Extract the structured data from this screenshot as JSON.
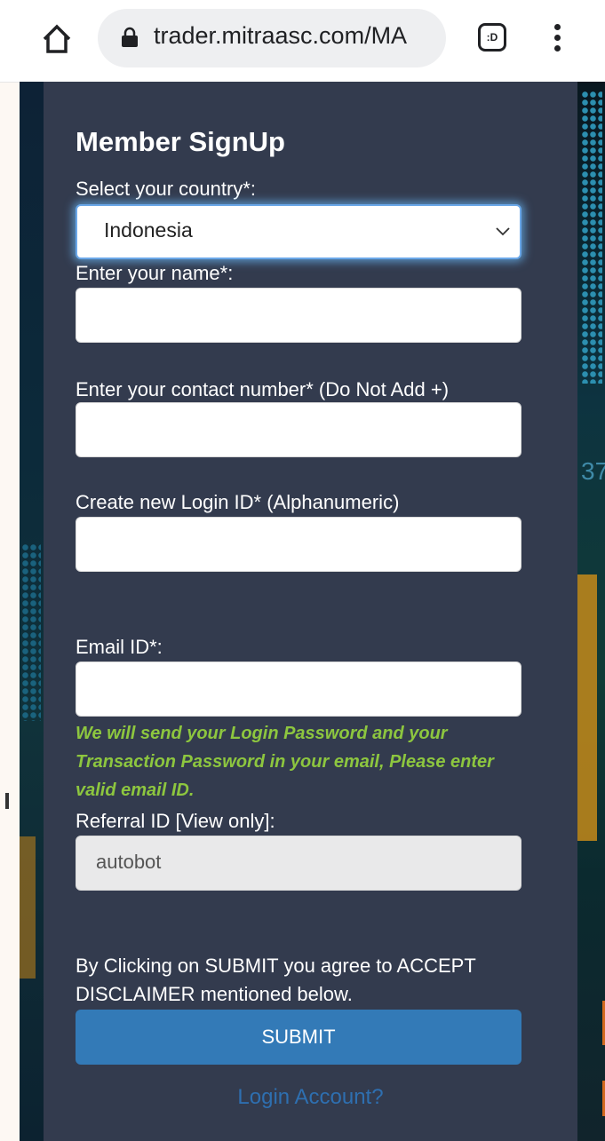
{
  "browser": {
    "url": "trader.mitraasc.com/MA",
    "tab_icon_text": ":D",
    "icons": [
      "home-icon",
      "lock-icon",
      "tab-switcher-icon",
      "more-vert-icon"
    ]
  },
  "background": {
    "right_number": "37"
  },
  "form": {
    "title": "Member SignUp",
    "country": {
      "label": "Select your country*:",
      "value": "Indonesia"
    },
    "name": {
      "label": "Enter your name*:",
      "value": ""
    },
    "contact": {
      "label": "Enter your contact number* (Do Not Add +)",
      "value": ""
    },
    "login_id": {
      "label": "Create new Login ID* (Alphanumeric)",
      "value": ""
    },
    "email": {
      "label": "Email ID*:",
      "value": ""
    },
    "email_note": "We will send your Login Password and your Transaction Password in your email, Please enter valid email ID.",
    "referral": {
      "label": "Referral ID [View only]:",
      "value": "autobot"
    },
    "disclaimer": "By Clicking on SUBMIT you agree to ACCEPT DISCLAIMER mentioned below.",
    "submit_label": "SUBMIT",
    "login_link": "Login Account?"
  },
  "colors": {
    "panel": "#333b4e",
    "note": "#8dc63f",
    "submit": "#337ab7",
    "link": "#2e6fb0"
  }
}
